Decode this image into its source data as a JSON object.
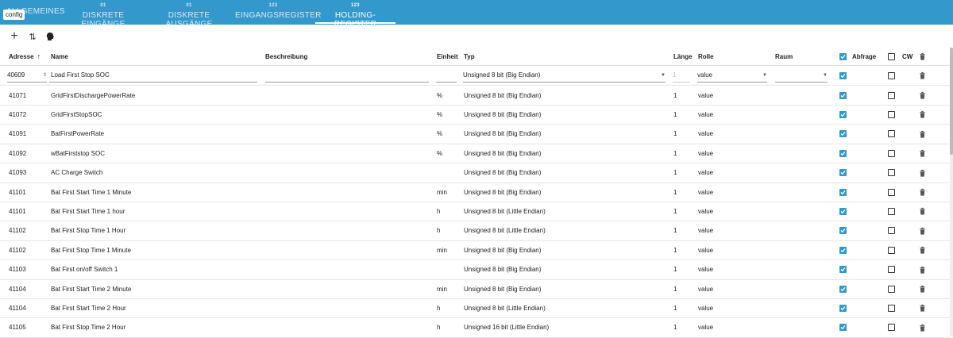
{
  "tabs": [
    {
      "badge": "",
      "label": "ALLGEMEINES"
    },
    {
      "badge": "01",
      "label": "DISKRETE EINGÄNGE"
    },
    {
      "badge": "01",
      "label": "DISKRETE AUSGÄNGE"
    },
    {
      "badge": "123",
      "label": "EINGANGSREGISTER"
    },
    {
      "badge": "123",
      "label": "HOLDING-REGISTER"
    }
  ],
  "tooltip": "config",
  "toolbar": {
    "add": "+",
    "sort": "⇅",
    "import": "☗"
  },
  "columns": {
    "address": "Adresse",
    "sort_arrow": "↑",
    "name": "Name",
    "description": "Beschreibung",
    "unit": "Einheit",
    "type": "Typ",
    "length": "Länge",
    "role": "Rolle",
    "room": "Raum",
    "poll": "Abfrage",
    "cw": "CW"
  },
  "edit_row": {
    "address": "40609",
    "name": "Load First Stop SOC",
    "description": "",
    "unit": "",
    "type": "Unsigned 8 bit (Big Endian)",
    "length": "1",
    "role": "value",
    "room": "",
    "poll": true,
    "cw": false
  },
  "rows": [
    {
      "address": "41071",
      "name": "GridFirstDischargePowerRate",
      "unit": "%",
      "type": "Unsigned 8 bit (Big Endian)",
      "length": "1",
      "role": "value",
      "poll": true,
      "cw": false
    },
    {
      "address": "41072",
      "name": "GridFirstStopSOC",
      "unit": "%",
      "type": "Unsigned 8 bit (Big Endian)",
      "length": "1",
      "role": "value",
      "poll": true,
      "cw": false
    },
    {
      "address": "41091",
      "name": "BatFirstPowerRate",
      "unit": "%",
      "type": "Unsigned 8 bit (Big Endian)",
      "length": "1",
      "role": "value",
      "poll": true,
      "cw": false
    },
    {
      "address": "41092",
      "name": "wBatFirststop SOC",
      "unit": "%",
      "type": "Unsigned 8 bit (Big Endian)",
      "length": "1",
      "role": "value",
      "poll": true,
      "cw": false
    },
    {
      "address": "41093",
      "name": "AC Charge Switch",
      "unit": "",
      "type": "Unsigned 8 bit (Big Endian)",
      "length": "1",
      "role": "value",
      "poll": true,
      "cw": false
    },
    {
      "address": "41101",
      "name": "Bat First Start Time 1 Minute",
      "unit": "min",
      "type": "Unsigned 8 bit (Big Endian)",
      "length": "1",
      "role": "value",
      "poll": true,
      "cw": false
    },
    {
      "address": "41101",
      "name": "Bat First Start Time 1 hour",
      "unit": "h",
      "type": "Unsigned 8 bit (Little Endian)",
      "length": "1",
      "role": "value",
      "poll": true,
      "cw": false
    },
    {
      "address": "41102",
      "name": "Bat First Stop Time 1 Hour",
      "unit": "h",
      "type": "Unsigned 8 bit (Little Endian)",
      "length": "1",
      "role": "value",
      "poll": true,
      "cw": false
    },
    {
      "address": "41102",
      "name": "Bat First Stop Time 1 Minute",
      "unit": "min",
      "type": "Unsigned 8 bit (Big Endian)",
      "length": "1",
      "role": "value",
      "poll": true,
      "cw": false
    },
    {
      "address": "41103",
      "name": "Bat First on/off Switch 1",
      "unit": "",
      "type": "Unsigned 8 bit (Big Endian)",
      "length": "1",
      "role": "value",
      "poll": true,
      "cw": false
    },
    {
      "address": "41104",
      "name": "Bat First Start Time 2 Minute",
      "unit": "min",
      "type": "Unsigned 8 bit (Big Endian)",
      "length": "1",
      "role": "value",
      "poll": true,
      "cw": false
    },
    {
      "address": "41104",
      "name": "Bat First Start Time 2 Hour",
      "unit": "h",
      "type": "Unsigned 8 bit (Little Endian)",
      "length": "1",
      "role": "value",
      "poll": true,
      "cw": false
    },
    {
      "address": "41105",
      "name": "Bat First Stop Time 2 Hour",
      "unit": "h",
      "type": "Unsigned 16 bit (Little Endian)",
      "length": "1",
      "role": "value",
      "poll": true,
      "cw": false
    }
  ],
  "colors": {
    "accent": "#3399cc",
    "tab_text": "#ffffff"
  }
}
